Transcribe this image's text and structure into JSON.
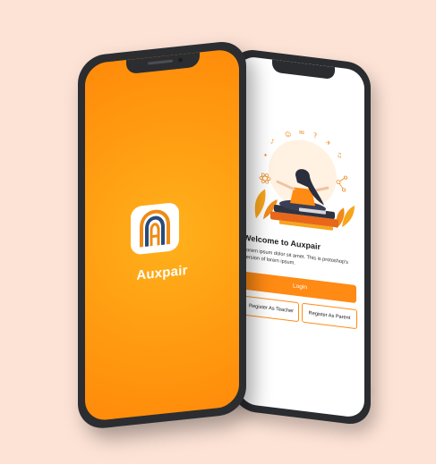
{
  "colors": {
    "background": "#fde3d6",
    "accent": "#ff8a14",
    "phone_frame": "#2b2d31"
  },
  "splash": {
    "app_name": "Auxpair",
    "logo_icon": "arch-logo-icon"
  },
  "welcome": {
    "title": "Welcome to Auxpair",
    "description": "Lorem ipsum dolor sit amet. This is protoshop's version of lorem ipsum.",
    "illustration_icon": "meditation-illustration",
    "login_label": "Login",
    "register_teacher_label": "Register As Teacher",
    "register_parent_label": "Register As Parent"
  }
}
